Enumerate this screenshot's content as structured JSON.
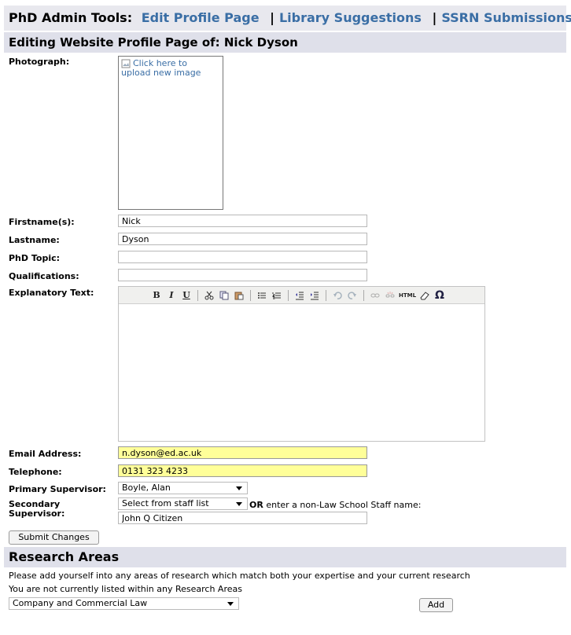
{
  "header": {
    "prefix": "PhD Admin Tools:",
    "links": [
      "Edit Profile Page",
      "Library Suggestions",
      "SSRN Submissions"
    ],
    "separator": "|"
  },
  "subheader": {
    "title": "Editing Website Profile Page of: Nick Dyson"
  },
  "photo": {
    "label": "Photograph:",
    "upload_text": "Click here to upload new image"
  },
  "fields": {
    "firstname_label": "Firstname(s):",
    "firstname_value": "Nick",
    "lastname_label": "Lastname:",
    "lastname_value": "Dyson",
    "topic_label": "PhD Topic:",
    "topic_value": "",
    "qualifications_label": "Qualifications:",
    "qualifications_value": "",
    "explanatory_label": "Explanatory Text:",
    "email_label": "Email Address:",
    "email_value": "n.dyson@ed.ac.uk",
    "telephone_label": "Telephone:",
    "telephone_value": "0131 323 4233",
    "primary_label": "Primary Supervisor:",
    "primary_value": "Boyle, Alan",
    "secondary_label": "Secondary Supervisor:",
    "secondary_value": "Select from staff list",
    "or_bold": "OR",
    "or_text": "enter a non-Law School Staff name:",
    "external_name_value": "John Q Citizen"
  },
  "editor_toolbar": {
    "bold": "B",
    "italic": "I",
    "underline": "U",
    "html": "HTML",
    "omega": "Ω"
  },
  "buttons": {
    "submit": "Submit Changes",
    "add": "Add"
  },
  "research": {
    "title": "Research Areas",
    "instruction": "Please add yourself into any areas of research which match both your expertise and your current research",
    "status": "You are not currently listed within any Research Areas",
    "selected_area": "Company and Commercial Law"
  },
  "colors": {
    "link": "#3a6ea5",
    "header_bg": "#dfe0ea",
    "highlight_field": "#ffff99"
  }
}
